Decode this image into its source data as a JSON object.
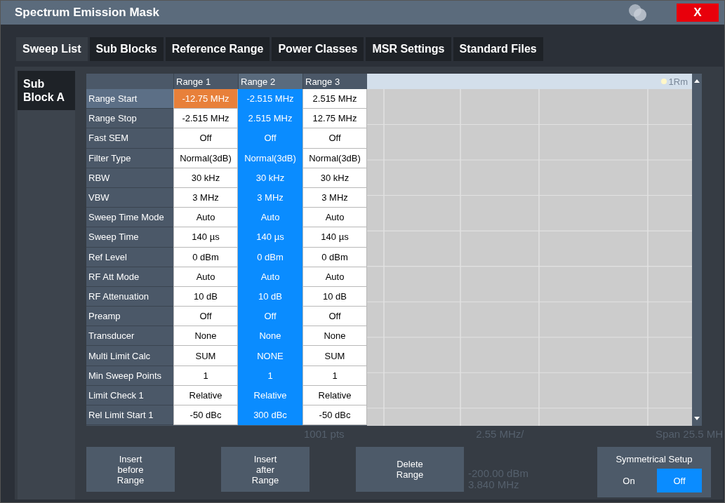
{
  "window": {
    "title": "Spectrum Emission Mask",
    "close_label": "X"
  },
  "tabs": [
    {
      "label": "Sweep List",
      "selected": true
    },
    {
      "label": "Sub Blocks",
      "selected": false
    },
    {
      "label": "Reference Range",
      "selected": false
    },
    {
      "label": "Power Classes",
      "selected": false
    },
    {
      "label": "MSR Settings",
      "selected": false
    },
    {
      "label": "Standard Files",
      "selected": false
    }
  ],
  "side_tabs": [
    {
      "label": "Sub Block A",
      "selected": true
    }
  ],
  "table": {
    "columns": [
      {
        "label": "Range 1",
        "selected": false
      },
      {
        "label": "Range 2",
        "selected": true
      },
      {
        "label": "Range 3",
        "selected": false
      }
    ],
    "rows": [
      {
        "label": "Range Start",
        "selected": true,
        "cells": [
          {
            "text": "-12.75 MHz",
            "focused": true
          },
          {
            "text": "-2.515 MHz",
            "focused": false
          },
          {
            "text": "2.515 MHz",
            "focused": false
          }
        ]
      },
      {
        "label": "Range Stop",
        "selected": false,
        "cells": [
          {
            "text": "-2.515 MHz",
            "focused": false
          },
          {
            "text": "2.515 MHz",
            "focused": false
          },
          {
            "text": "12.75 MHz",
            "focused": false
          }
        ]
      },
      {
        "label": "Fast SEM",
        "selected": false,
        "cells": [
          {
            "text": "Off",
            "focused": false
          },
          {
            "text": "Off",
            "focused": false
          },
          {
            "text": "Off",
            "focused": false
          }
        ]
      },
      {
        "label": "Filter Type",
        "selected": false,
        "cells": [
          {
            "text": "Normal(3dB)",
            "focused": false
          },
          {
            "text": "Normal(3dB)",
            "focused": false
          },
          {
            "text": "Normal(3dB)",
            "focused": false
          }
        ]
      },
      {
        "label": "RBW",
        "selected": false,
        "cells": [
          {
            "text": "30 kHz",
            "focused": false
          },
          {
            "text": "30 kHz",
            "focused": false
          },
          {
            "text": "30 kHz",
            "focused": false
          }
        ]
      },
      {
        "label": "VBW",
        "selected": false,
        "cells": [
          {
            "text": "3 MHz",
            "focused": false
          },
          {
            "text": "3 MHz",
            "focused": false
          },
          {
            "text": "3 MHz",
            "focused": false
          }
        ]
      },
      {
        "label": "Sweep Time Mode",
        "selected": false,
        "cells": [
          {
            "text": "Auto",
            "focused": false
          },
          {
            "text": "Auto",
            "focused": false
          },
          {
            "text": "Auto",
            "focused": false
          }
        ]
      },
      {
        "label": "Sweep Time",
        "selected": false,
        "cells": [
          {
            "text": "140 µs",
            "focused": false
          },
          {
            "text": "140 µs",
            "focused": false
          },
          {
            "text": "140 µs",
            "focused": false
          }
        ]
      },
      {
        "label": "Ref Level",
        "selected": false,
        "cells": [
          {
            "text": "0 dBm",
            "focused": false
          },
          {
            "text": "0 dBm",
            "focused": false
          },
          {
            "text": "0 dBm",
            "focused": false
          }
        ]
      },
      {
        "label": "RF Att Mode",
        "selected": false,
        "cells": [
          {
            "text": "Auto",
            "focused": false
          },
          {
            "text": "Auto",
            "focused": false
          },
          {
            "text": "Auto",
            "focused": false
          }
        ]
      },
      {
        "label": "RF Attenuation",
        "selected": false,
        "cells": [
          {
            "text": "10 dB",
            "focused": false
          },
          {
            "text": "10 dB",
            "focused": false
          },
          {
            "text": "10 dB",
            "focused": false
          }
        ]
      },
      {
        "label": "Preamp",
        "selected": false,
        "cells": [
          {
            "text": "Off",
            "focused": false
          },
          {
            "text": "Off",
            "focused": false
          },
          {
            "text": "Off",
            "focused": false
          }
        ]
      },
      {
        "label": "Transducer",
        "selected": false,
        "cells": [
          {
            "text": "None",
            "focused": false
          },
          {
            "text": "None",
            "focused": false
          },
          {
            "text": "None",
            "focused": false
          }
        ]
      },
      {
        "label": "Multi Limit Calc",
        "selected": false,
        "cells": [
          {
            "text": "SUM",
            "focused": false
          },
          {
            "text": "NONE",
            "focused": false
          },
          {
            "text": "SUM",
            "focused": false
          }
        ]
      },
      {
        "label": "Min Sweep Points",
        "selected": false,
        "cells": [
          {
            "text": "1",
            "focused": false
          },
          {
            "text": "1",
            "focused": false
          },
          {
            "text": "1",
            "focused": false
          }
        ]
      },
      {
        "label": "Limit Check 1",
        "selected": false,
        "cells": [
          {
            "text": "Relative",
            "focused": false
          },
          {
            "text": "Relative",
            "focused": false
          },
          {
            "text": "Relative",
            "focused": false
          }
        ]
      },
      {
        "label": "Rel Limit Start 1",
        "selected": false,
        "cells": [
          {
            "text": "-50 dBc",
            "focused": false
          },
          {
            "text": "300 dBc",
            "focused": false
          },
          {
            "text": "-50 dBc",
            "focused": false
          }
        ]
      }
    ]
  },
  "trace_label": "1Rm",
  "background_readouts": [
    "1001 pts",
    "2.55 MHz/",
    "Span 25.5 MH"
  ],
  "background_readouts_lower": [
    "-200.00 dBm",
    "3.840 MHz"
  ],
  "buttons": [
    {
      "label": "Insert\nbefore\nRange"
    },
    {
      "label": "Insert\nafter\nRange"
    },
    {
      "label": "Delete\nRange"
    }
  ],
  "symmetrical_setup": {
    "title": "Symmetrical Setup",
    "options": [
      {
        "label": "On",
        "selected": false
      },
      {
        "label": "Off",
        "selected": true
      }
    ]
  }
}
